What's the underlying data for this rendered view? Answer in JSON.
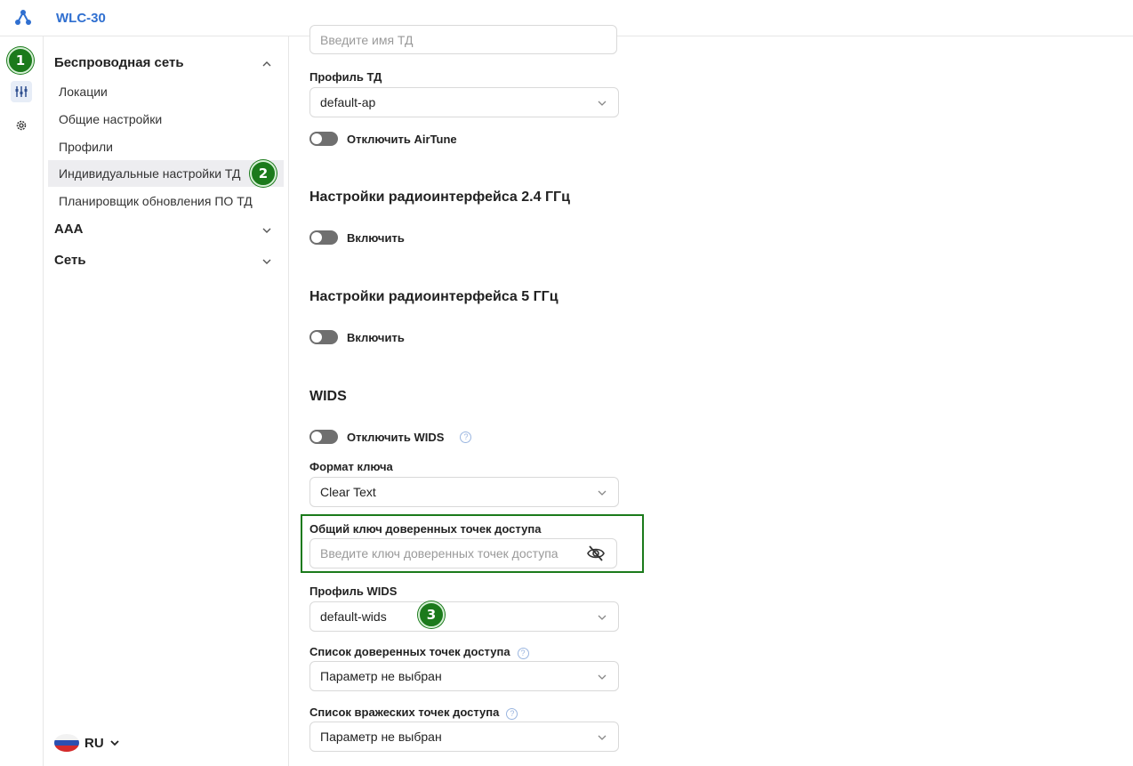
{
  "app": {
    "title": "WLC-30"
  },
  "badges": {
    "b1": "1",
    "b2": "2",
    "b3": "3"
  },
  "sidebar": {
    "wireless": {
      "label": "Беспроводная сеть",
      "items": [
        {
          "label": "Локации"
        },
        {
          "label": "Общие настройки"
        },
        {
          "label": "Профили"
        },
        {
          "label": "Индивидуальные настройки ТД"
        },
        {
          "label": "Планировщик обновления ПО ТД"
        }
      ]
    },
    "aaa": {
      "label": "AAA"
    },
    "network": {
      "label": "Сеть"
    }
  },
  "language": {
    "code": "RU"
  },
  "form": {
    "ap_name": {
      "placeholder": "Введите имя ТД"
    },
    "ap_profile": {
      "label": "Профиль ТД",
      "value": "default-ap"
    },
    "airtune": {
      "label": "Отключить AirTune"
    },
    "radio24": {
      "title": "Настройки радиоинтерфейса 2.4 ГГц",
      "toggle_label": "Включить"
    },
    "radio5": {
      "title": "Настройки радиоинтерфейса 5 ГГц",
      "toggle_label": "Включить"
    },
    "wids": {
      "title": "WIDS",
      "disable_label": "Отключить WIDS",
      "key_format": {
        "label": "Формат ключа",
        "value": "Clear Text"
      },
      "trusted_key": {
        "label": "Общий ключ доверенных точек доступа",
        "placeholder": "Введите ключ доверенных точек доступа"
      },
      "profile": {
        "label": "Профиль WIDS",
        "value": "default-wids"
      },
      "trusted_list": {
        "label": "Список доверенных точек доступа",
        "value": "Параметр не выбран"
      },
      "rogue_list": {
        "label": "Список вражеских точек доступа",
        "value": "Параметр не выбран"
      }
    }
  },
  "colors": {
    "accent": "#2f6fd0",
    "badge": "#1b7a1b",
    "highlight": "#1b7a1b"
  }
}
